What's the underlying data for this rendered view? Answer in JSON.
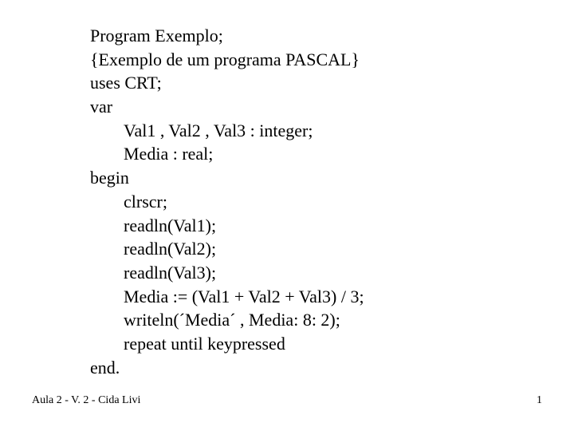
{
  "code": {
    "l0": "Program Exemplo;",
    "l1": "{Exemplo de um programa PASCAL}",
    "l2": "uses CRT;",
    "l3": "var",
    "l4": "Val1 , Val2 , Val3 : integer;",
    "l5": "Media : real;",
    "l6": "begin",
    "l7": "clrscr;",
    "l8": "readln(Val1);",
    "l9": "readln(Val2);",
    "l10": "readln(Val3);",
    "l11": "Media := (Val1 + Val2 + Val3) / 3;",
    "l12": "writeln(´Media´ , Media: 8: 2);",
    "l13": "repeat until keypressed",
    "l14": "end."
  },
  "footer": {
    "left": "Aula 2 - V. 2 - Cida Livi",
    "page": "1"
  }
}
